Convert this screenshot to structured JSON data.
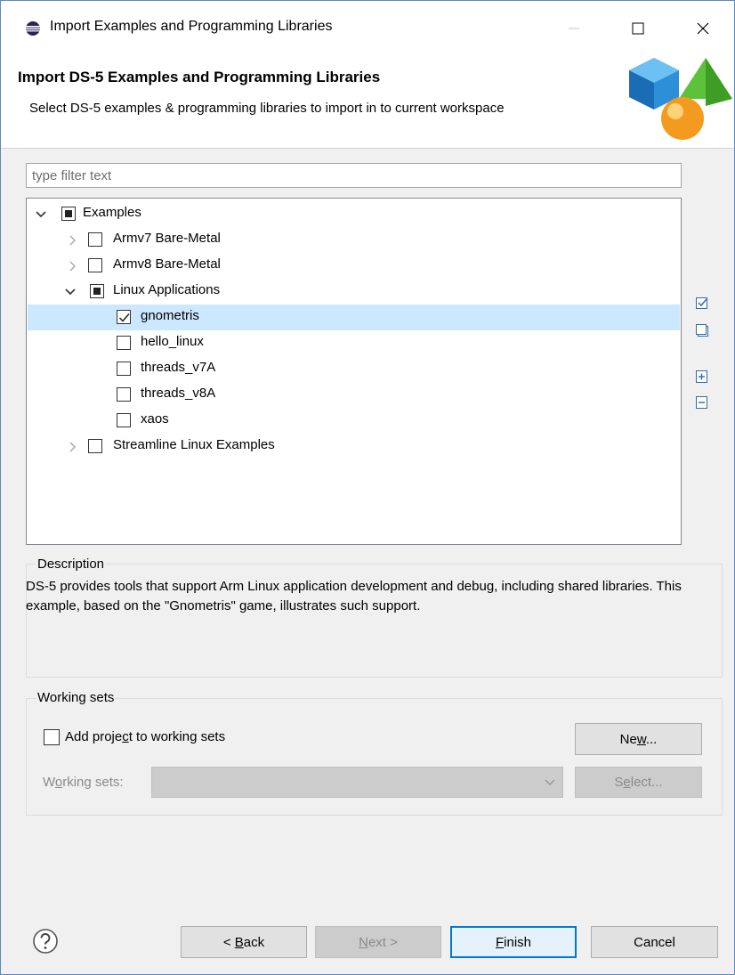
{
  "window": {
    "title": "Import Examples and Programming Libraries"
  },
  "banner": {
    "title": "Import DS-5 Examples and Programming Libraries",
    "description": "Select DS-5 examples & programming libraries to import in to current workspace"
  },
  "filter": {
    "placeholder": "type filter text",
    "value": ""
  },
  "tree": [
    {
      "label": "Examples",
      "level": 0,
      "expanded": true,
      "state": "partial"
    },
    {
      "label": "Armv7 Bare-Metal",
      "level": 1,
      "expanded": false,
      "state": "unchecked"
    },
    {
      "label": "Armv8 Bare-Metal",
      "level": 1,
      "expanded": false,
      "state": "unchecked"
    },
    {
      "label": "Linux Applications",
      "level": 1,
      "expanded": true,
      "state": "partial"
    },
    {
      "label": "gnometris",
      "level": 2,
      "state": "checked",
      "selected": true
    },
    {
      "label": "hello_linux",
      "level": 2,
      "state": "unchecked"
    },
    {
      "label": "threads_v7A",
      "level": 2,
      "state": "unchecked"
    },
    {
      "label": "threads_v8A",
      "level": 2,
      "state": "unchecked"
    },
    {
      "label": "xaos",
      "level": 2,
      "state": "unchecked"
    },
    {
      "label": "Streamline Linux Examples",
      "level": 1,
      "expanded": false,
      "state": "unchecked"
    }
  ],
  "side_buttons": [
    "select-all-icon",
    "deselect-all-icon",
    "expand-all-icon",
    "collapse-all-icon"
  ],
  "description": {
    "title": "Description",
    "text": "DS-5 provides tools that support Arm Linux application development and debug, including shared libraries. This example, based on the \"Gnometris\" game, illustrates such support."
  },
  "working_sets": {
    "title": "Working sets",
    "add_label_pre": "Add proje",
    "add_label_mn": "c",
    "add_label_post": "t to working sets",
    "add_checked": false,
    "new_pre": "Ne",
    "new_mn": "w",
    "new_post": "...",
    "sets_pre": "W",
    "sets_mn": "o",
    "sets_post": "rking sets:",
    "select_pre": "S",
    "select_mn": "e",
    "select_post": "lect..."
  },
  "footer": {
    "back_pre": "< ",
    "back_mn": "B",
    "back_post": "ack",
    "next_mn": "N",
    "next_post": "ext >",
    "finish_mn": "F",
    "finish_post": "inish",
    "cancel": "Cancel"
  },
  "colors": {
    "selection": "#cce8ff",
    "default_button_border": "#0078d7",
    "window_border": "#5b8bc2"
  }
}
